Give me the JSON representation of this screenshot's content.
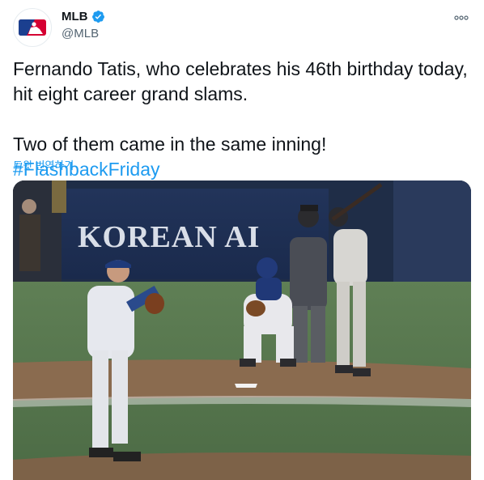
{
  "author": {
    "name": "MLB",
    "handle": "@MLB",
    "verified": true,
    "avatar_icon": "mlb-logo-icon"
  },
  "tweet": {
    "line1": "Fernando Tatis, who celebrates his 46th birthday today,",
    "line2": "hit eight career grand slams.",
    "line3": "Two of them came in the same inning! ",
    "hashtag": "#FlashbackFriday",
    "translate_label": "트윗 번역하기"
  },
  "media": {
    "type": "video-frame",
    "banner_text": "KOREAN AI"
  },
  "colors": {
    "accent": "#1d9bf0",
    "text": "#0f1419",
    "secondary": "#536471",
    "mlb_blue": "#1b3f8f",
    "mlb_red": "#d50032"
  }
}
